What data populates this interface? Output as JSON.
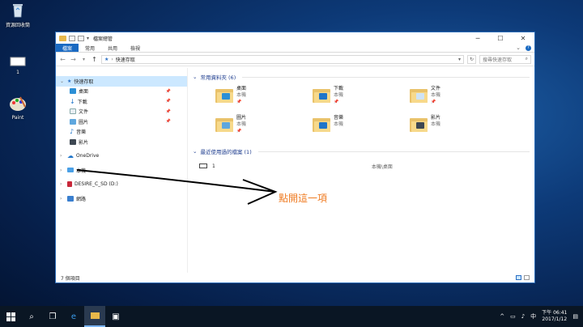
{
  "desktop": {
    "icons": [
      {
        "label": "資源回收筒"
      },
      {
        "label": "1"
      },
      {
        "label": "Paint"
      }
    ]
  },
  "window": {
    "title": "檔案總管",
    "controls": {
      "minimize": "─",
      "maximize": "☐",
      "close": "✕"
    },
    "ribbon_tabs": [
      "檔案",
      "常用",
      "共用",
      "檢視"
    ],
    "ribbon_expand": "⌄",
    "help": "?",
    "address": {
      "path": "快速存取",
      "search_placeholder": "搜尋快速存取"
    },
    "nav_pane": {
      "quick_access": "快速存取",
      "quick_items": [
        {
          "label": "桌面",
          "pinned": true
        },
        {
          "label": "下載",
          "pinned": true
        },
        {
          "label": "文件",
          "pinned": true
        },
        {
          "label": "圖片",
          "pinned": true
        },
        {
          "label": "音樂",
          "pinned": false
        },
        {
          "label": "影片",
          "pinned": false
        }
      ],
      "onedrive": "OneDrive",
      "this_pc": "本機",
      "drive": "DESIRE_C_SD (D:)",
      "network": "網路"
    },
    "frequent": {
      "header": "常用資料夾 (6)",
      "folders": [
        {
          "name": "桌面",
          "location": "本機",
          "pinned": true,
          "badge_color": "#2b8fd6"
        },
        {
          "name": "下載",
          "location": "本機",
          "pinned": true,
          "badge_color": "#1f75c9"
        },
        {
          "name": "文件",
          "location": "本機",
          "pinned": true,
          "badge_color": "#cfe3f5"
        },
        {
          "name": "圖片",
          "location": "本機",
          "pinned": true,
          "badge_color": "#5ea7de"
        },
        {
          "name": "音樂",
          "location": "本機",
          "pinned": false,
          "badge_color": "#1f75c9"
        },
        {
          "name": "影片",
          "location": "本機",
          "pinned": false,
          "badge_color": "#3d4752"
        }
      ]
    },
    "recent": {
      "header": "最近使用過的檔案 (1)",
      "files": [
        {
          "name": "1",
          "path": "本機\\桌面"
        }
      ]
    },
    "status": {
      "count": "7 個項目"
    }
  },
  "annotation": {
    "text": "點開這一項",
    "color": "#ef7a20"
  },
  "taskbar": {
    "clock_time": "下午 06:41",
    "clock_date": "2017/1/12",
    "ime": "中"
  }
}
